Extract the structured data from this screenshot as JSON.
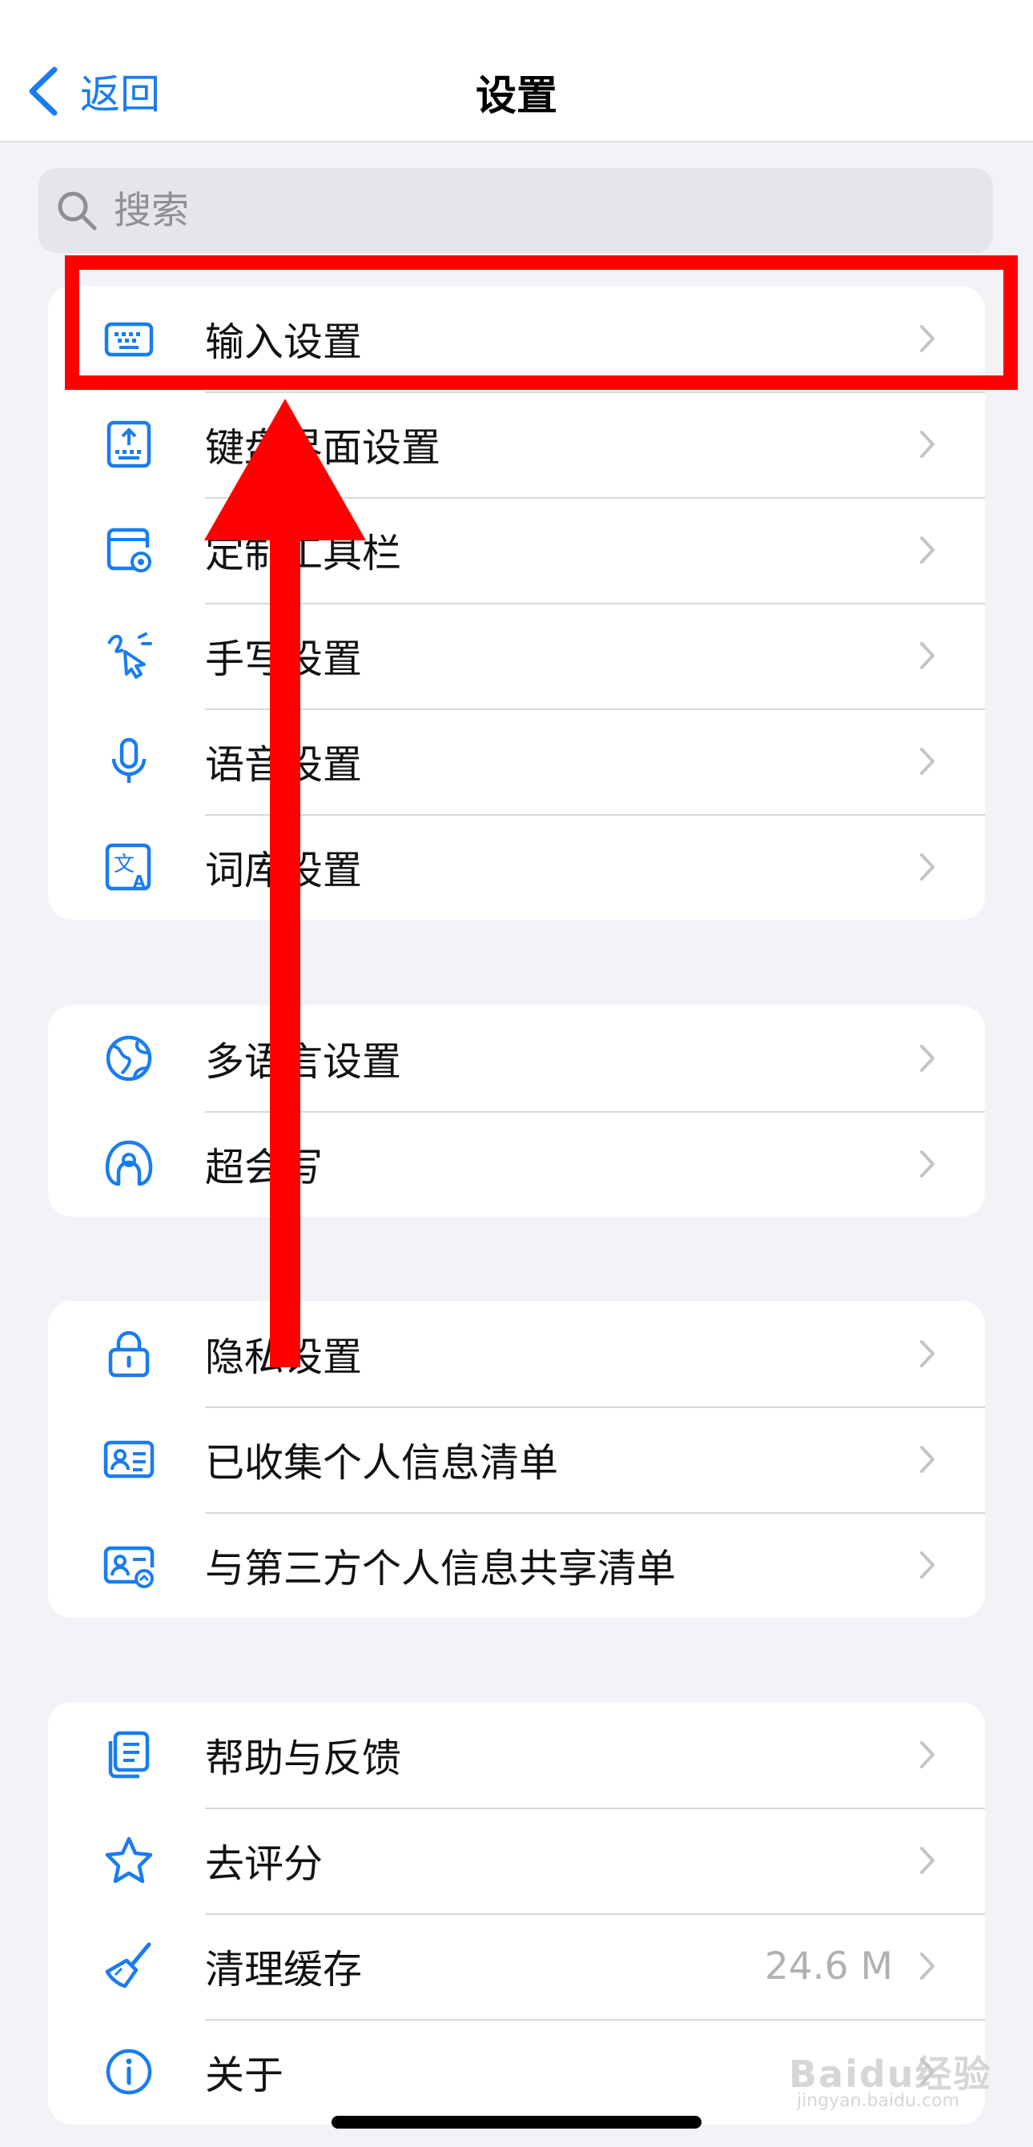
{
  "nav": {
    "back_label": "返回",
    "title": "设置"
  },
  "search": {
    "placeholder": "搜索"
  },
  "groups": [
    {
      "items": [
        {
          "label": "输入设置",
          "icon": "keyboard-icon"
        },
        {
          "label": "键盘界面设置",
          "icon": "keyboard-upload-icon"
        },
        {
          "label": "定制工具栏",
          "icon": "toolbar-gear-icon"
        },
        {
          "label": "手写设置",
          "icon": "handwriting-icon"
        },
        {
          "label": "语音设置",
          "icon": "microphone-icon"
        },
        {
          "label": "词库设置",
          "icon": "dictionary-icon"
        }
      ]
    },
    {
      "items": [
        {
          "label": "多语言设置",
          "icon": "globe-icon"
        },
        {
          "label": "超会写",
          "icon": "super-write-icon"
        }
      ]
    },
    {
      "items": [
        {
          "label": "隐私设置",
          "icon": "lock-icon"
        },
        {
          "label": "已收集个人信息清单",
          "icon": "id-card-icon"
        },
        {
          "label": "与第三方个人信息共享清单",
          "icon": "id-card-share-icon"
        }
      ]
    },
    {
      "items": [
        {
          "label": "帮助与反馈",
          "icon": "document-stack-icon"
        },
        {
          "label": "去评分",
          "icon": "star-icon"
        },
        {
          "label": "清理缓存",
          "icon": "brush-icon",
          "value": "24.6 M"
        },
        {
          "label": "关于",
          "icon": "info-icon"
        }
      ]
    }
  ],
  "watermark": {
    "logo": "Baidu经验",
    "url": "jingyan.baidu.com"
  },
  "colors": {
    "accent": "#1a7cf0",
    "annotation": "#ff0000",
    "background": "#f2f2f7"
  }
}
